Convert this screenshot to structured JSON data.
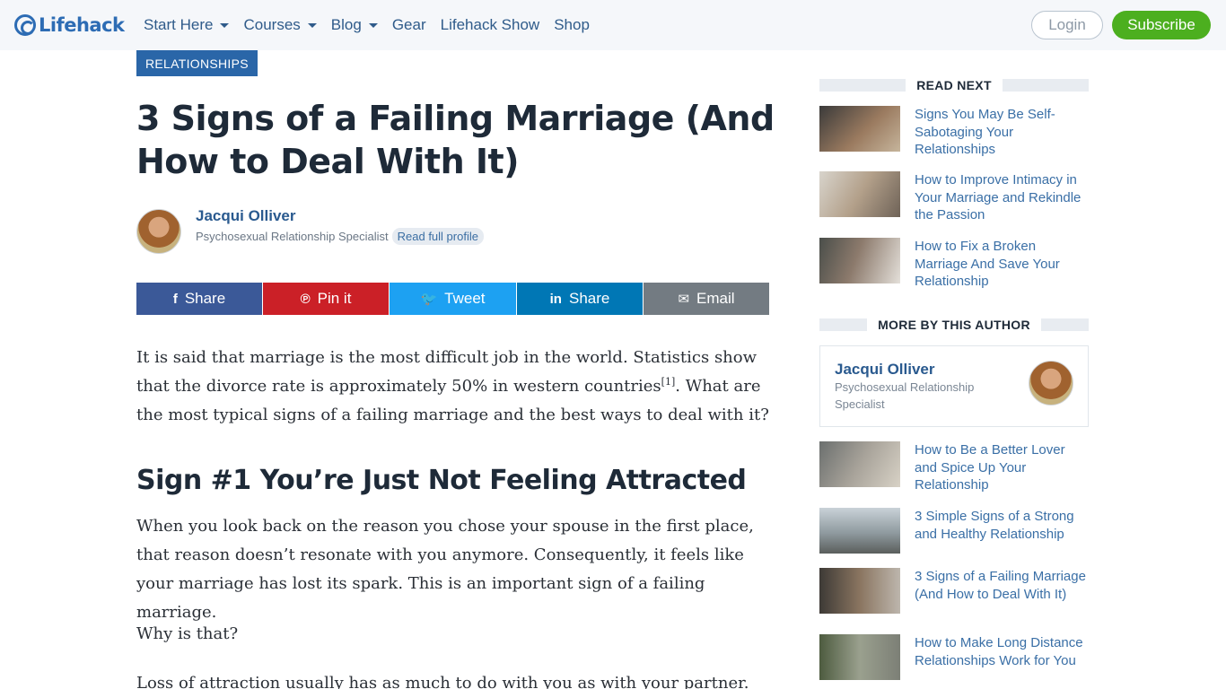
{
  "nav": {
    "logo_text": "Lifehack",
    "items": [
      {
        "label": "Start Here",
        "dropdown": true
      },
      {
        "label": "Courses",
        "dropdown": true
      },
      {
        "label": "Blog",
        "dropdown": true
      },
      {
        "label": "Gear",
        "dropdown": false
      },
      {
        "label": "Lifehack Show",
        "dropdown": false
      },
      {
        "label": "Shop",
        "dropdown": false
      }
    ],
    "login_label": "Login",
    "subscribe_label": "Subscribe"
  },
  "article": {
    "category": "RELATIONSHIPS",
    "title": "3 Signs of a Failing Marriage (And How to Deal With It)",
    "author": {
      "name": "Jacqui Olliver",
      "role": "Psychosexual Relationship Specialist",
      "profile_link": "Read full profile"
    },
    "share": [
      {
        "label": "Share",
        "icon": "facebook-icon",
        "glyph": "f",
        "color": "#3b5998"
      },
      {
        "label": "Pin it",
        "icon": "pinterest-icon",
        "glyph": "℗",
        "color": "#cb2027"
      },
      {
        "label": "Tweet",
        "icon": "twitter-icon",
        "glyph": "🐦",
        "color": "#1da1f2"
      },
      {
        "label": "Share",
        "icon": "linkedin-icon",
        "glyph": "in",
        "color": "#0077b5"
      },
      {
        "label": "Email",
        "icon": "email-icon",
        "glyph": "✉",
        "color": "#737b82"
      }
    ],
    "intro_part1": "It is said that marriage is the most difficult job in the world. Statistics show that the divorce rate is approximately 50% in western countries",
    "intro_ref": "[1]",
    "intro_part2": ". What are the most typical signs of a failing marriage and the best ways to deal with it?",
    "heading1": "Sign #1 You’re Just Not Feeling Attracted",
    "para1": "When you look back on the reason you chose your spouse in the first place, that reason doesn’t resonate with you anymore. Consequently, it feels like your marriage has lost its spark. This is an important sign of a failing marriage.",
    "para2": "Why is that?",
    "para3": "Loss of attraction usually has as much to do with you as with your partner."
  },
  "sidebar": {
    "read_next_label": "READ NEXT",
    "read_next": [
      {
        "title": "Signs You May Be Self-Sabotaging Your Relationships"
      },
      {
        "title": "How to Improve Intimacy in Your Marriage and Rekindle the Passion"
      },
      {
        "title": "How to Fix a Broken Marriage And Save Your Relationship"
      }
    ],
    "more_label": "MORE BY THIS AUTHOR",
    "author_box": {
      "name": "Jacqui Olliver",
      "role": "Psychosexual Relationship Specialist"
    },
    "more": [
      {
        "title": "How to Be a Better Lover and Spice Up Your Relationship"
      },
      {
        "title": "3 Simple Signs of a Strong and Healthy Relationship"
      },
      {
        "title": "3 Signs of a Failing Marriage (And How to Deal With It)"
      },
      {
        "title": "How to Make Long Distance Relationships Work for You"
      }
    ]
  }
}
